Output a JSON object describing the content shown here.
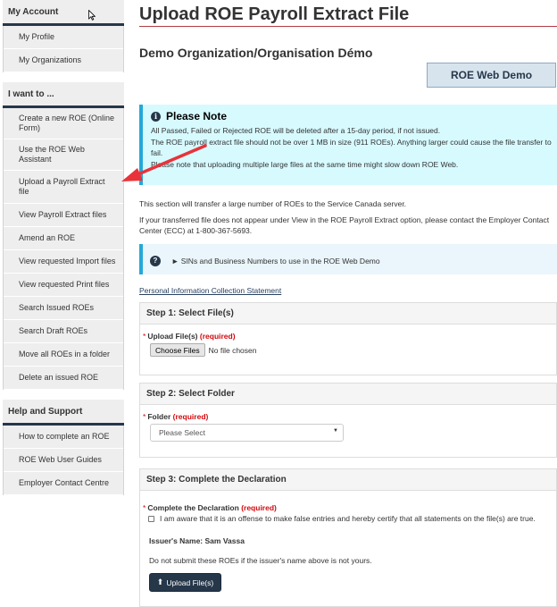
{
  "sidebar": {
    "account": {
      "heading": "My Account",
      "items": [
        {
          "label": "My Profile"
        },
        {
          "label": "My Organizations"
        }
      ]
    },
    "want": {
      "heading": "I want to ...",
      "items": [
        {
          "label": "Create a new ROE (Online Form)"
        },
        {
          "label": "Use the ROE Web Assistant"
        },
        {
          "label": "Upload a Payroll Extract file"
        },
        {
          "label": "View Payroll Extract files"
        },
        {
          "label": "Amend an ROE"
        },
        {
          "label": "View requested Import files"
        },
        {
          "label": "View requested Print files"
        },
        {
          "label": "Search Issued ROEs"
        },
        {
          "label": "Search Draft ROEs"
        },
        {
          "label": "Move all ROEs in a folder"
        },
        {
          "label": "Delete an issued ROE"
        }
      ]
    },
    "help": {
      "heading": "Help and Support",
      "items": [
        {
          "label": "How to complete an ROE"
        },
        {
          "label": "ROE Web User Guides"
        },
        {
          "label": "Employer Contact Centre"
        }
      ]
    }
  },
  "main": {
    "title": "Upload ROE Payroll Extract File",
    "org": "Demo Organization/Organisation Démo",
    "demo_badge": "ROE Web Demo",
    "note": {
      "title": "Please Note",
      "line1": "All Passed, Failed or Rejected ROE will be deleted after a 15-day period, if not issued.",
      "line2": "The ROE payroll extract file should not be over 1 MB in size (911 ROEs). Anything larger could cause the file transfer to fail.",
      "line3": "Please note that uploading multiple large files at the same time might slow down ROE Web."
    },
    "intro1": "This section will transfer a large number of ROEs to the Service Canada server.",
    "intro2": "If your transferred file does not appear under View in the ROE Payroll Extract option, please contact the Employer Contact Center (ECC) at 1-800-367-5693.",
    "sin_text": "► SINs and Business Numbers to use in the ROE Web Demo",
    "privacy_link": "Personal Information Collection Statement",
    "step1": {
      "heading": "Step 1: Select File(s)",
      "label": "Upload File(s)",
      "required": "(required)",
      "choose_button": "Choose Files",
      "no_file": "No file chosen"
    },
    "step2": {
      "heading": "Step 2: Select Folder",
      "label": "Folder",
      "required": "(required)",
      "select_value": "Please Select"
    },
    "step3": {
      "heading": "Step 3: Complete the Declaration",
      "label": "Complete the Declaration",
      "required": "(required)",
      "checkbox_text": "I am aware that it is an offense to make false entries and hereby certify that all statements on the file(s) are true.",
      "issuer": "Issuer's Name: Sam Vassa",
      "warning": "Do not submit these ROEs if the issuer's name above is not yours.",
      "upload_button": "Upload File(s)"
    }
  },
  "colors": {
    "navy": "#26374a",
    "alert_bg": "#d7faff",
    "alert_border": "#26a8d8",
    "required": "#d3080c",
    "arrow": "#e8333a"
  }
}
